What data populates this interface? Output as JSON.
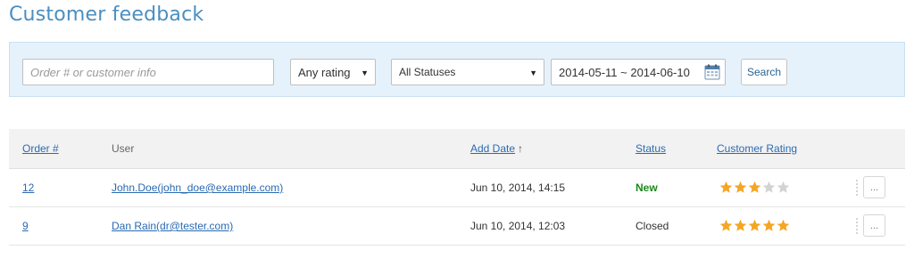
{
  "page": {
    "title": "Customer feedback"
  },
  "filters": {
    "search_placeholder": "Order # or customer info",
    "rating_value": "Any rating",
    "status_value": "All Statuses",
    "date_range": "2014-05-11 ~ 2014-06-10",
    "search_label": "Search"
  },
  "table": {
    "headers": {
      "order": "Order #",
      "user": "User",
      "add_date": "Add Date",
      "sort_indicator": "↑",
      "status": "Status",
      "rating": "Customer Rating"
    },
    "rows": [
      {
        "order": "12",
        "user": "John.Doe(john_doe@example.com)",
        "date": "Jun 10, 2014, 14:15",
        "status": "New",
        "rating": 3,
        "more_label": "..."
      },
      {
        "order": "9",
        "user": "Dan Rain(dr@tester.com)",
        "date": "Jun 10, 2014, 12:03",
        "status": "Closed",
        "rating": 5,
        "more_label": "..."
      }
    ],
    "rating_max": 5
  },
  "colors": {
    "accent": "#4a8fc1",
    "link": "#2a6ab2",
    "filter_bg": "#e6f2fb",
    "status_new": "#1a8a1a",
    "star_filled": "#f5a623",
    "star_empty": "#d3d3d3"
  },
  "icons": {
    "calendar": "calendar-icon",
    "star": "star-icon",
    "caret": "chevron-down-icon",
    "grip": "drag-handle-icon"
  }
}
